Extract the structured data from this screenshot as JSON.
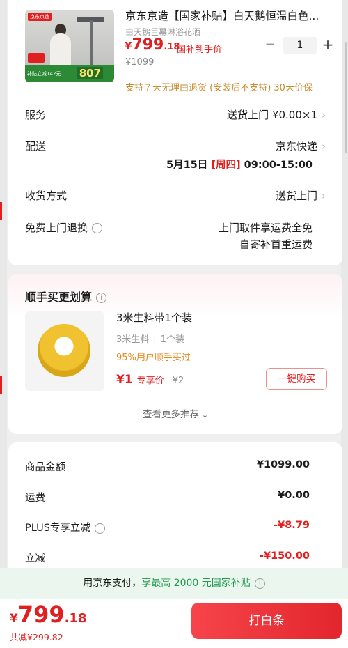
{
  "product": {
    "title": "京东京造【国家补贴】白天鹅恒温白色...",
    "subtitle": "白天鹅巨幕淋浴花洒",
    "price_symbol": "¥",
    "price_int": "799",
    "price_dec": ".18",
    "price_tag": "国补到手价",
    "original_price": "¥1099",
    "quantity": "1",
    "minus": "−",
    "plus": "+",
    "return_policy": "支持７天无理由退货 (安装后不支持)   30天价保",
    "image_texts": {
      "tag": "京东京造",
      "b1": "补贴立减142元",
      "b2": "国补到手价",
      "b3": "807"
    }
  },
  "rows": {
    "service_label": "服务",
    "service_value": "送货上门  ¥0.00×1",
    "delivery_label": "配送",
    "delivery_value": "京东快递",
    "delivery_date": "5月15日",
    "delivery_weekday": "[周四]",
    "delivery_time": "09:00-15:00",
    "receive_label": "收货方式",
    "receive_value": "送货上门",
    "free_return_label": "免费上门退换",
    "free_return_line1": "上门取件享运费全免",
    "free_return_line2": "自寄补首重运费"
  },
  "recommend": {
    "title": "顺手买更划算",
    "item_name": "3米生料带1个装",
    "spec1": "3米生料",
    "spec2": "1个装",
    "popularity": "95%用户顺手买过",
    "price": "¥1",
    "price_label": "专享价",
    "original_price": "¥2",
    "buy_button": "一键购买",
    "more": "查看更多推荐"
  },
  "summary": {
    "goods_label": "商品金额",
    "goods_value": "¥1099.00",
    "shipping_label": "运费",
    "shipping_value": "¥0.00",
    "plus_label": "PLUS专享立减",
    "plus_value": "-¥8.79",
    "discount_label": "立减",
    "discount_value": "-¥150.00"
  },
  "banner": {
    "prefix": "用京东支付，",
    "highlight": "享最高 2000 元国家补贴"
  },
  "bottom": {
    "price_symbol": "¥",
    "price_int": "799",
    "price_dec": ".18",
    "total_saved": "共减¥299.82",
    "pay_button": "打白条"
  },
  "colors": {
    "accent": "#e02020",
    "green": "#1f9a4c",
    "banner_bg": "#eaf6ee"
  },
  "icons": [
    "chevron-right-icon",
    "info-icon",
    "chevron-down-icon"
  ]
}
